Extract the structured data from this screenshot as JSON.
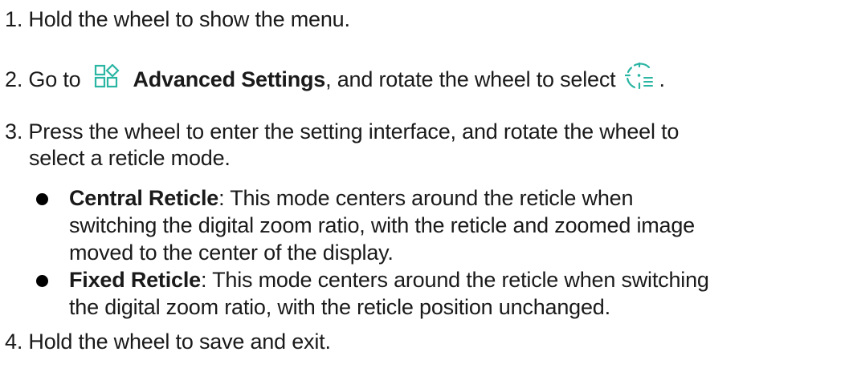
{
  "steps": {
    "step1": "1. Hold the wheel to show the menu.",
    "step2": {
      "prefix": "2. Go to",
      "icon": "advanced-settings-icon",
      "bold": "Advanced Settings",
      "suffix": ", and rotate the wheel to select",
      "select_icon": "reticle-mode-icon",
      "end": "."
    },
    "step3": {
      "line1": "3. Press the wheel to enter the setting interface, and rotate the wheel to",
      "line2": "select a reticle mode.",
      "bullets": [
        {
          "term": "Central Reticle",
          "lines": [
            ": This mode centers around the reticle when",
            "switching the digital zoom ratio, with the reticle and zoomed image",
            "moved to the center of the display."
          ]
        },
        {
          "term": "Fixed Reticle",
          "lines": [
            ": This mode centers around the reticle when switching",
            "the digital zoom ratio, with the reticle position unchanged."
          ]
        }
      ]
    },
    "step4": "4. Hold the wheel to save and exit."
  },
  "colors": {
    "text": "#1a1a1a",
    "icon_accent": "#2bb5a3"
  }
}
